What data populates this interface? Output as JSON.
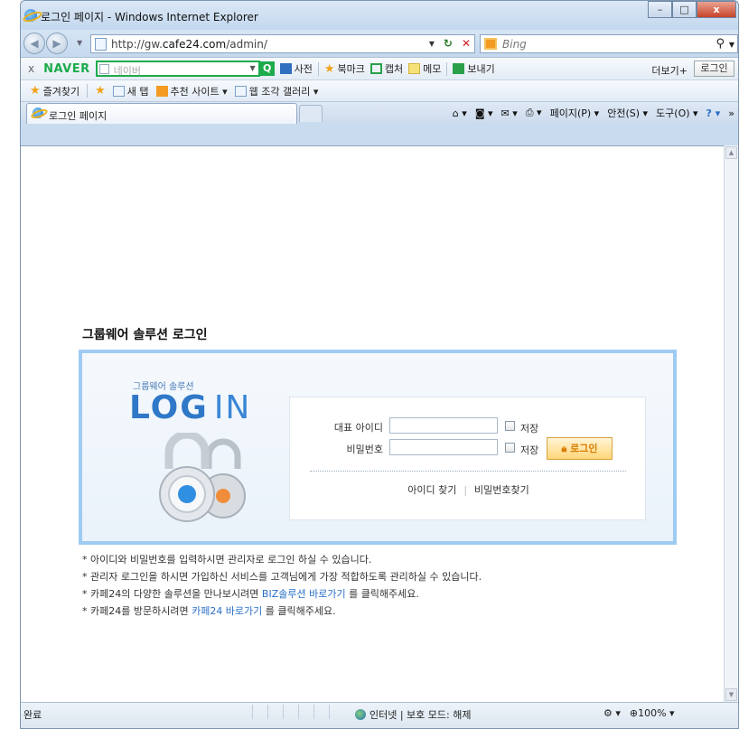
{
  "window": {
    "title": "로그인 페이지 - Windows Internet Explorer",
    "minimize": "–",
    "maximize": "□",
    "close": "x"
  },
  "address": {
    "prefix": "http://gw.",
    "domain": "cafe24.com",
    "path": "/admin/",
    "search_placeholder": "Bing",
    "refresh": "↻",
    "stop": "✕"
  },
  "naver_bar": {
    "close": "x",
    "brand": "NAVER",
    "search_placeholder": "네이버",
    "go": "Q",
    "items": [
      "사전",
      "북마크",
      "캡처",
      "메모",
      "보내기"
    ],
    "more": "더보기+",
    "login": "로그인"
  },
  "favorites": {
    "label": "즐겨찾기",
    "items": [
      "새 탭",
      "추천 사이트 ▾",
      "웹 조각 갤러리 ▾"
    ]
  },
  "tabs": {
    "active": "로그인 페이지"
  },
  "commands": {
    "page": "페이지(P) ▾",
    "safety": "안전(S) ▾",
    "tools": "도구(O) ▾",
    "chev": "»"
  },
  "page": {
    "heading": "그룹웨어 솔루션 로그인",
    "sub": "그룹웨어 솔루션",
    "big_log": "LOG",
    "big_in": "IN",
    "id_label": "대표 아이디",
    "pw_label": "비밀번호",
    "save_label": "저장",
    "login_button": "로그인",
    "find_id": "아이디 찾기",
    "find_pw": "비밀번호찾기",
    "notes": {
      "n1": "* 아이디와 비밀번호를 입력하시면 관리자로 로그인 하실 수 있습니다.",
      "n2": "* 관리자 로그인을 하시면 가입하신 서비스를 고객님에게 가장 적합하도록 관리하실 수 있습니다.",
      "n3_pre": "* 카페24의 다양한 솔루션을 만나보시려면 ",
      "n3_link": "BIZ솔루션 바로가기",
      "n3_post": " 를 클릭해주세요.",
      "n4_pre": "* 카페24를 방문하시려면 ",
      "n4_link": "카페24 바로가기",
      "n4_post": " 를 클릭해주세요."
    }
  },
  "status": {
    "left": "완료",
    "zone": "인터넷 | 보호 모드: 해제",
    "zoom": "100%"
  },
  "colors": {
    "panel_border": "#9fcbf3",
    "brand_blue": "#2f78c8",
    "naver_green": "#1dab4b",
    "login_orange": "#d97c00"
  }
}
